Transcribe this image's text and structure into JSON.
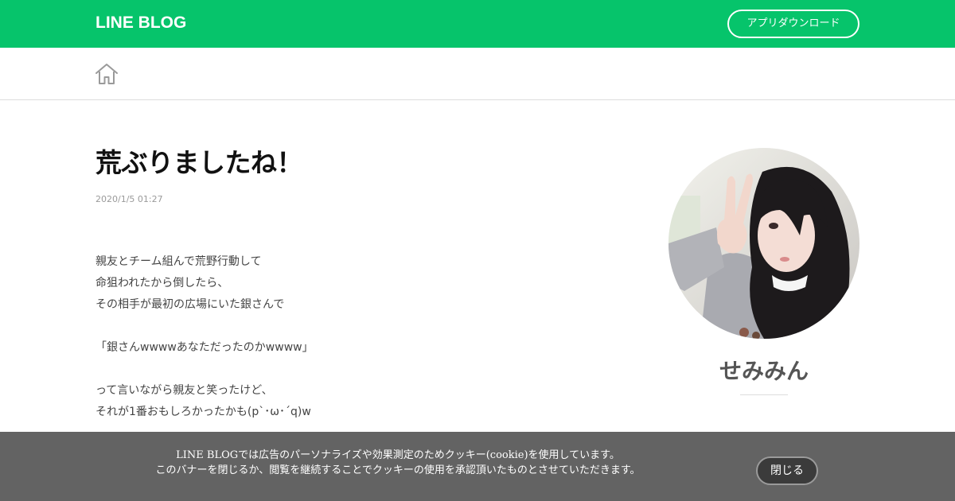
{
  "header": {
    "logo": "LINE BLOG",
    "app_download_label": "アプリダウンロード",
    "brand_color": "#06c46b"
  },
  "nav": {
    "home_icon": "home-icon"
  },
  "post": {
    "title": "荒ぶりましたね！",
    "date": "2020/1/5 01:27",
    "body_lines": [
      "親友とチーム組んで荒野行動して",
      "命狙われたから倒したら、",
      "その相手が最初の広場にいた銀さんで",
      "",
      "「銀さんwwwwあなただったのかwwww」",
      "",
      "って言いながら親友と笑ったけど、",
      "それが1番おもしろかったかも(p`･ω･´q)w"
    ]
  },
  "sidebar": {
    "author_name": "せみみん",
    "avatar_icon": "avatar"
  },
  "cookie_banner": {
    "line1": "LINE BLOGでは広告のパーソナライズや効果測定のためクッキー(cookie)を使用しています。",
    "line2": "このバナーを閉じるか、閲覧を継続することでクッキーの使用を承認頂いたものとさせていただきます。",
    "close_label": "閉じる"
  }
}
